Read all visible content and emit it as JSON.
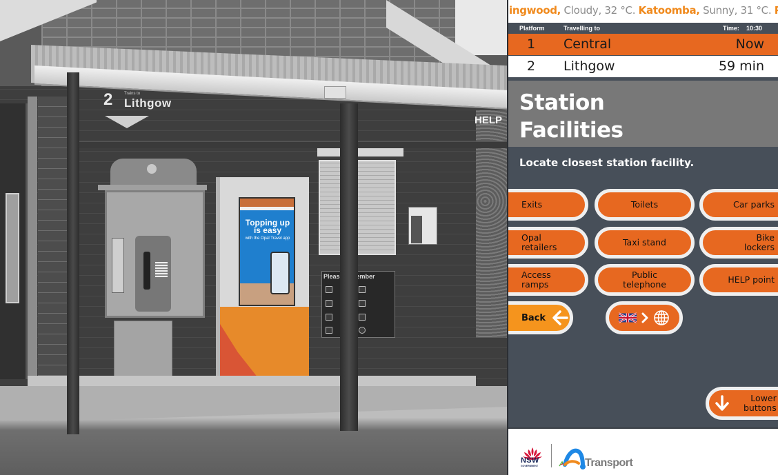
{
  "photo": {
    "platform_sign": {
      "number": "2",
      "trains_to": "Trains to",
      "destination": "Lithgow"
    },
    "help_sign": "HELP",
    "kiosk_promo": {
      "headline": "Topping up is easy",
      "sub": "with the Opal Travel app"
    },
    "notice_title": "Please remember"
  },
  "screen": {
    "ticker": [
      {
        "place": "ingwood,",
        "weather": "Cloudy, 32 °C."
      },
      {
        "place": "Katoomba,",
        "weather": "Sunny, 31 °C."
      },
      {
        "place": "Pen",
        "weather": ""
      }
    ],
    "departures": {
      "header": {
        "platform": "Platform",
        "travelling_to": "Travelling to",
        "time_label": "Time:",
        "time_value": "10:30"
      },
      "rows": [
        {
          "platform": "1",
          "destination": "Central",
          "due": "Now",
          "highlighted": true
        },
        {
          "platform": "2",
          "destination": "Lithgow",
          "due": "59 min",
          "highlighted": false
        }
      ]
    },
    "title_line1": "Station",
    "title_line2": "Facilities",
    "subtitle": "Locate closest station facility.",
    "facilities": [
      {
        "label": "Exits"
      },
      {
        "label": "Toilets"
      },
      {
        "label": "Car parks"
      },
      {
        "label": "Opal retailers"
      },
      {
        "label": "Taxi stand"
      },
      {
        "label": "Bike lockers"
      },
      {
        "label": "Access ramps"
      },
      {
        "label": "Public telephone"
      },
      {
        "label": "HELP point"
      }
    ],
    "back_label": "Back",
    "language_button": {
      "flag_icon": "uk-flag-icon",
      "arrow_icon": "chevron-right-icon",
      "globe_icon": "globe-icon"
    },
    "lower_buttons_label_1": "Lower",
    "lower_buttons_label_2": "buttons",
    "footer": {
      "nsw": "NSW",
      "government": "GOVERNMENT",
      "transport": "Transport"
    },
    "colors": {
      "accent_orange": "#e76820",
      "back_orange": "#f5941d",
      "ticker_place": "#f08a1d",
      "panel_bg": "#474f59",
      "title_band": "#787878"
    }
  }
}
